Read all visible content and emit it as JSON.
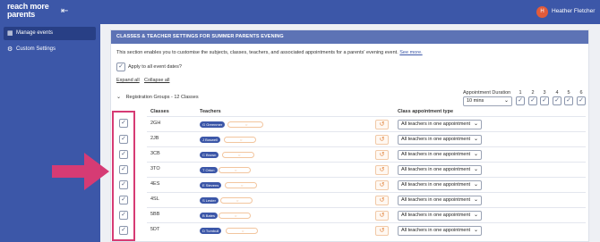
{
  "header": {
    "logo_text": "reach more parents",
    "user_initials": "H",
    "user_name": "Heather Fletcher"
  },
  "sidebar": {
    "items": [
      {
        "label": "Manage events",
        "icon": "calendar-icon",
        "active": true
      },
      {
        "label": "Custom Settings",
        "icon": "gear-icon",
        "active": false
      }
    ]
  },
  "panel": {
    "title": "CLASSES & TEACHER SETTINGS FOR SUMMER PARENTS EVENING",
    "intro": "This section enables you to customise the subjects, classes, teachers, and associated appointments for a parents' evening event.",
    "intro_link": "See more.",
    "apply_all_label": "Apply to all event dates?",
    "expand_all": "Expand all",
    "collapse_all": "Collapse all",
    "group_label": "Registration Groups - 12 Classes",
    "appointment_duration_label": "Appointment Duration",
    "appointment_duration_value": "10 mins",
    "duration_columns": [
      "1",
      "2",
      "3",
      "4",
      "5",
      "6"
    ],
    "col_classes": "Classes",
    "col_teachers": "Teachers",
    "col_appt_type": "Class appointment type"
  },
  "rows": [
    {
      "class": "2GH",
      "teacher": "G Greenmer",
      "appt_type": "All teachers in one appointment"
    },
    {
      "class": "2JB",
      "teacher": "J Boswell",
      "appt_type": "All teachers in one appointment"
    },
    {
      "class": "3CB",
      "teacher": "C Brown",
      "appt_type": "All teachers in one appointment"
    },
    {
      "class": "3TO",
      "teacher": "T Orton",
      "appt_type": "All teachers in one appointment"
    },
    {
      "class": "4ES",
      "teacher": "E Stevens",
      "appt_type": "All teachers in one appointment"
    },
    {
      "class": "4SL",
      "teacher": "S Lester",
      "appt_type": "All teachers in one appointment"
    },
    {
      "class": "5BB",
      "teacher": "B Bates",
      "appt_type": "All teachers in one appointment"
    },
    {
      "class": "5DT",
      "teacher": "D Turnbull",
      "appt_type": "All teachers in one appointment"
    }
  ],
  "colors": {
    "brand": "#3c57a8",
    "highlight": "#d63b74",
    "reset_accent": "#e0833c"
  }
}
